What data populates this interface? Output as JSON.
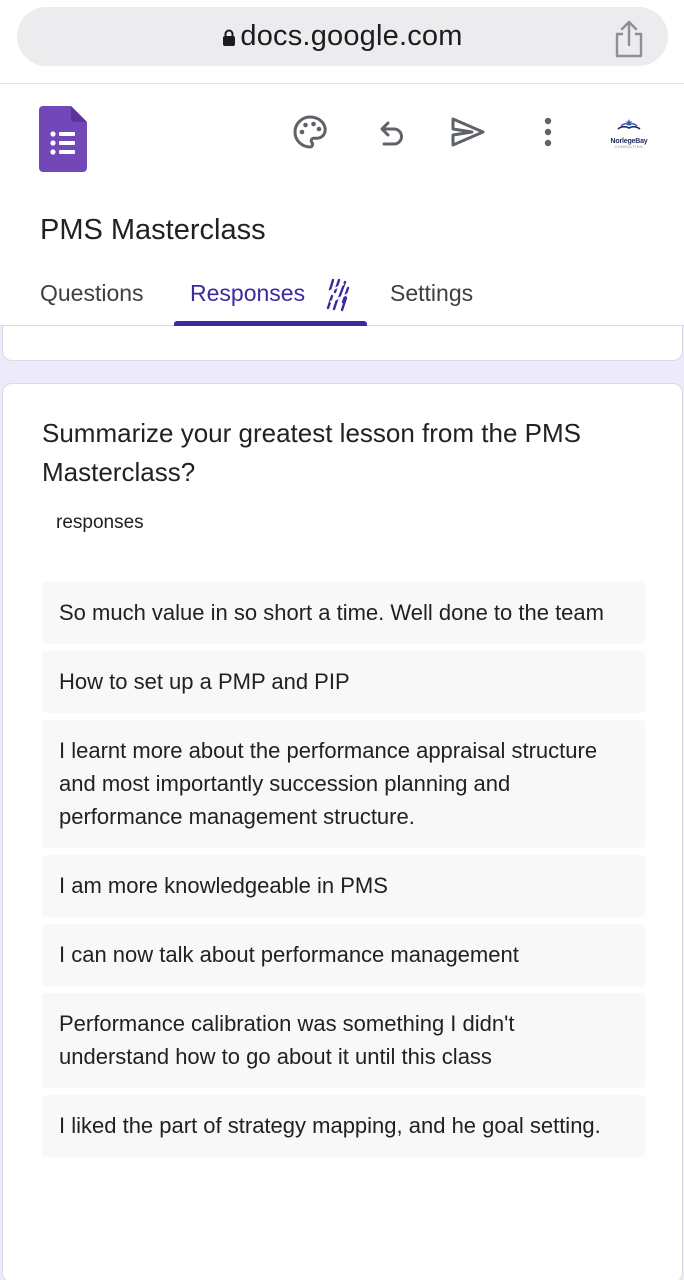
{
  "browser": {
    "url": "docs.google.com",
    "lock_icon": "lock-icon",
    "share_icon": "share-icon"
  },
  "header": {
    "app_icon": "google-forms-icon",
    "toolbar": {
      "palette_icon": "palette-icon",
      "undo_icon": "undo-icon",
      "send_icon": "send-icon",
      "more_icon": "more-vert-icon"
    },
    "brand_logo_text": "NorlegeBay",
    "brand_logo_sub": "CONSULTING",
    "form_title": "PMS Masterclass"
  },
  "tabs": [
    {
      "label": "Questions"
    },
    {
      "label": "Responses"
    },
    {
      "label": "Settings"
    }
  ],
  "colors": {
    "accent": "#3b2aa1",
    "forms_purple": "#7248b9",
    "content_background": "#edeafc",
    "answer_background": "#f8f8f8"
  },
  "question_card": {
    "question": "Summarize your greatest lesson from the PMS Masterclass?",
    "response_count": "responses",
    "answers": [
      "So much value in so short a time. Well done to the team",
      "How to set up a PMP and PIP",
      "I learnt more about the performance appraisal structure and most importantly succession planning and performance management structure.",
      "I am more knowledgeable in PMS",
      "I can now talk about performance management",
      "Performance calibration was something I didn't understand how to go about it until this class",
      "I liked the part of strategy mapping, and he goal setting."
    ]
  }
}
